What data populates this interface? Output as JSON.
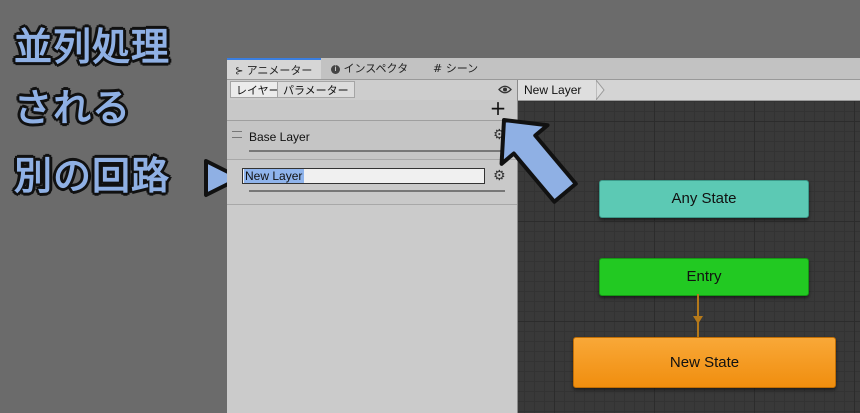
{
  "annotation": {
    "lines": [
      "並列処理",
      "される",
      "別の回路"
    ]
  },
  "window": {
    "tabs": [
      {
        "label": "アニメーター",
        "icon": "animator-icon",
        "active": true
      },
      {
        "label": "インスペクター",
        "icon": "info-icon",
        "active": false
      },
      {
        "label": "シーン",
        "icon": "grid-icon",
        "active": false
      }
    ]
  },
  "panel": {
    "subtabs": [
      {
        "label": "レイヤー",
        "active": true
      },
      {
        "label": "パラメーター",
        "active": false
      }
    ],
    "add_label": "+",
    "layers": [
      {
        "name": "Base Layer"
      },
      {
        "name": "New Layer",
        "editing": true
      }
    ]
  },
  "graph": {
    "breadcrumb": "New Layer",
    "nodes": [
      {
        "label": "Any State",
        "color": "#5cc9b4"
      },
      {
        "label": "Entry",
        "color": "#22c922"
      },
      {
        "label": "New State",
        "color": "#f59a1b"
      }
    ],
    "transition_color": "#b5791a"
  },
  "colors": {
    "accent": "#3a7ee0",
    "arrow": "#8fb0e4",
    "arrow_outline": "#111111"
  }
}
